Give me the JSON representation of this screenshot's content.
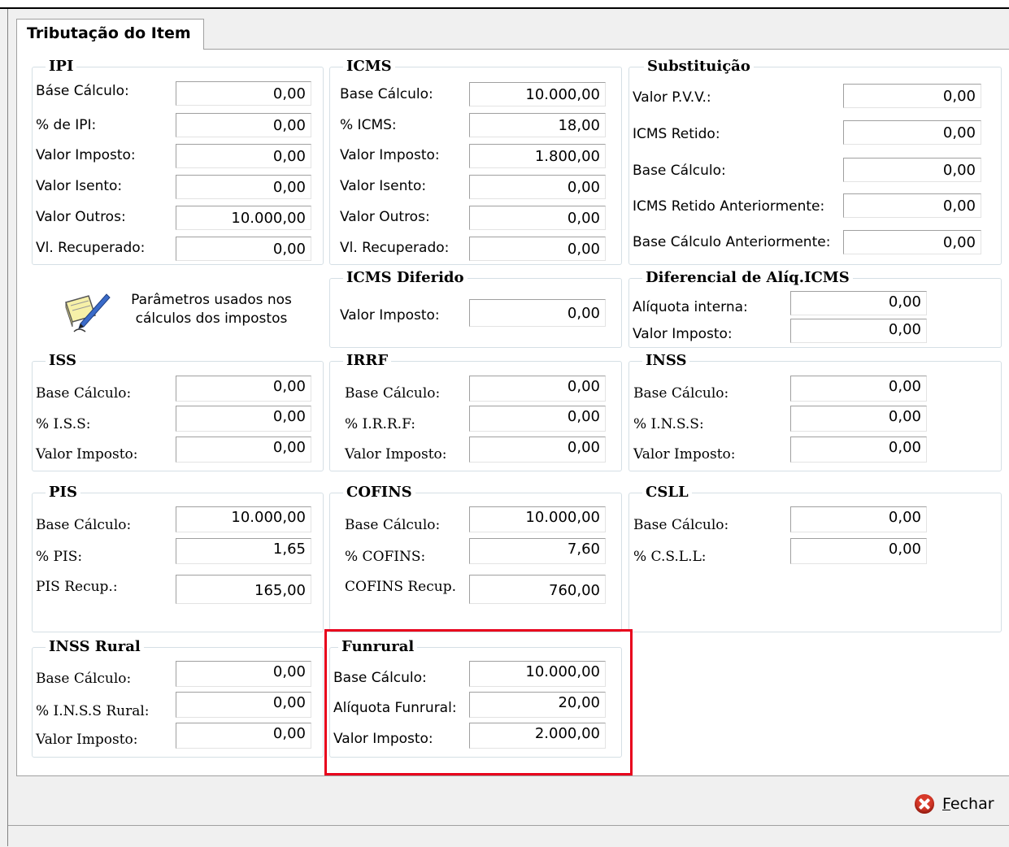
{
  "tab": {
    "label": "Tributação do Item"
  },
  "ipi": {
    "title": "IPI",
    "rows": [
      {
        "label": "Báse Cálculo:",
        "value": "0,00"
      },
      {
        "label": "% de IPI:",
        "value": "0,00"
      },
      {
        "label": "Valor Imposto:",
        "value": "0,00"
      },
      {
        "label": "Valor Isento:",
        "value": "0,00"
      },
      {
        "label": "Valor Outros:",
        "value": "10.000,00"
      },
      {
        "label": "Vl. Recuperado:",
        "value": "0,00"
      }
    ]
  },
  "icms": {
    "title": "ICMS",
    "rows": [
      {
        "label": "Base Cálculo:",
        "value": "10.000,00"
      },
      {
        "label": "% ICMS:",
        "value": "18,00"
      },
      {
        "label": "Valor Imposto:",
        "value": "1.800,00"
      },
      {
        "label": "Valor Isento:",
        "value": "0,00"
      },
      {
        "label": "Valor Outros:",
        "value": "0,00"
      },
      {
        "label": "Vl. Recuperado:",
        "value": "0,00"
      }
    ]
  },
  "substituicao": {
    "title": "Substituição",
    "rows": [
      {
        "label": "Valor P.V.V.:",
        "value": "0,00"
      },
      {
        "label": "ICMS Retido:",
        "value": "0,00"
      },
      {
        "label": "Base Cálculo:",
        "value": "0,00"
      },
      {
        "label": "ICMS Retido Anteriormente:",
        "value": "0,00"
      },
      {
        "label": "Base Cálculo Anteriormente:",
        "value": "0,00"
      }
    ]
  },
  "params": {
    "text": "Parâmetros usados nos cálculos dos impostos",
    "icon": "pencil-notepad-icon"
  },
  "icms_diferido": {
    "title": "ICMS Diferido",
    "rows": [
      {
        "label": "Valor Imposto:",
        "value": "0,00"
      }
    ]
  },
  "diferencial": {
    "title": "Diferencial de Alíq.ICMS",
    "rows": [
      {
        "label": "Alíquota interna:",
        "value": "0,00"
      },
      {
        "label": "Valor Imposto:",
        "value": "0,00"
      }
    ]
  },
  "iss": {
    "title": "ISS",
    "rows": [
      {
        "label": "Base Cálculo:",
        "value": "0,00"
      },
      {
        "label": "% I.S.S:",
        "value": "0,00"
      },
      {
        "label": "Valor Imposto:",
        "value": "0,00"
      }
    ]
  },
  "irrf": {
    "title": "IRRF",
    "rows": [
      {
        "label": "Base Cálculo:",
        "value": "0,00"
      },
      {
        "label": "% I.R.R.F:",
        "value": "0,00"
      },
      {
        "label": "Valor Imposto:",
        "value": "0,00"
      }
    ]
  },
  "inss": {
    "title": "INSS",
    "rows": [
      {
        "label": "Base Cálculo:",
        "value": "0,00"
      },
      {
        "label": "% I.N.S.S:",
        "value": "0,00"
      },
      {
        "label": "Valor Imposto:",
        "value": "0,00"
      }
    ]
  },
  "pis": {
    "title": "PIS",
    "rows": [
      {
        "label": "Base Cálculo:",
        "value": "10.000,00"
      },
      {
        "label": "% PIS:",
        "value": "1,65"
      },
      {
        "label": "PIS Recup.:",
        "value": "165,00"
      }
    ]
  },
  "cofins": {
    "title": "COFINS",
    "rows": [
      {
        "label": "Base Cálculo:",
        "value": "10.000,00"
      },
      {
        "label": "% COFINS:",
        "value": "7,60"
      },
      {
        "label": "COFINS Recup.",
        "value": "760,00"
      }
    ]
  },
  "csll": {
    "title": "CSLL",
    "rows": [
      {
        "label": "Base Cálculo:",
        "value": "0,00"
      },
      {
        "label": "% C.S.L.L:",
        "value": "0,00"
      }
    ]
  },
  "inss_rural": {
    "title": "INSS Rural",
    "rows": [
      {
        "label": "Base Cálculo:",
        "value": "0,00"
      },
      {
        "label": "% I.N.S.S Rural:",
        "value": "0,00"
      },
      {
        "label": "Valor Imposto:",
        "value": "0,00"
      }
    ]
  },
  "funrural": {
    "title": "Funrural",
    "rows": [
      {
        "label": "Base Cálculo:",
        "value": "10.000,00"
      },
      {
        "label": "Alíquota Funrural:",
        "value": "20,00"
      },
      {
        "label": "Valor Imposto:",
        "value": "2.000,00"
      }
    ]
  },
  "footer": {
    "close_label": "Fechar",
    "close_icon": "close-icon"
  },
  "colors": {
    "highlight": "#e8001c",
    "close_icon": "#d83a2a"
  }
}
